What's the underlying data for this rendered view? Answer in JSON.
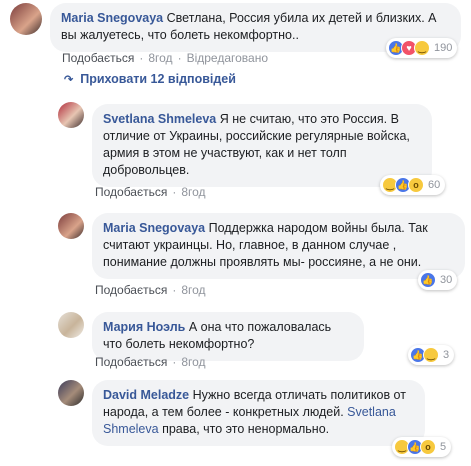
{
  "comments": [
    {
      "author": "Maria Snegovaya",
      "text": "Светлана, Россия убила их детей и близких. А вы жалуетесь, что болеть некомфортно..",
      "actions": {
        "like": "Подобається",
        "time": "8год",
        "edited": "Відредаговано"
      },
      "reactions": {
        "icons": [
          "like-icon",
          "love-icon",
          "haha-icon"
        ],
        "count": "190"
      }
    },
    {
      "author": "Svetlana Shmeleva",
      "text": "Я не считаю, что это Россия. В отличие от Украины, российские регулярные войска, армия в этом не участвуют, как и нет толп добровольцев.",
      "actions": {
        "like": "Подобається",
        "time": "8год"
      },
      "reactions": {
        "icons": [
          "haha-icon",
          "like-icon",
          "wow-icon"
        ],
        "count": "60"
      }
    },
    {
      "author": "Maria Snegovaya",
      "text": "Поддержка народом войны была. Так считают украинцы. Но, главное, в данном случае , понимание должны проявлять мы- россияне, а не они.",
      "actions": {
        "like": "Подобається",
        "time": "8год"
      },
      "reactions": {
        "icons": [
          "like-icon"
        ],
        "count": "30"
      }
    },
    {
      "author": "Мария Ноэль",
      "text": "А она что пожаловалась что болеть некомфортно?",
      "actions": {
        "like": "Подобається",
        "time": "8год"
      },
      "reactions": {
        "icons": [
          "like-icon",
          "haha-icon"
        ],
        "count": "3"
      }
    },
    {
      "author": "David Meladze",
      "text_before": "Нужно всегда отличать политиков от народа, а тем более - конкретных людей. ",
      "mention": "Svetlana Shmeleva",
      "text_after": " права, что это ненормально.",
      "reactions": {
        "icons": [
          "haha-icon",
          "like-icon",
          "wow-icon"
        ],
        "count": "5"
      }
    }
  ],
  "hide_replies": "Приховати 12 відповідей",
  "colors": {
    "link": "#385898",
    "bubble": "#f2f3f5",
    "meta": "#90949c"
  }
}
